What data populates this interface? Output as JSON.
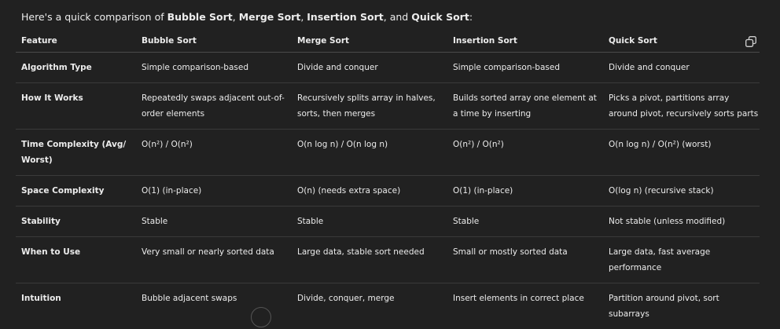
{
  "intro": {
    "prefix": "Here's a quick comparison of ",
    "bubble": "Bubble Sort",
    "sep1": ", ",
    "merge": "Merge Sort",
    "sep2": ", ",
    "insertion": "Insertion Sort",
    "sep3": ", and ",
    "quick": "Quick Sort",
    "suffix": ":"
  },
  "table": {
    "headers": [
      "Feature",
      "Bubble Sort",
      "Merge Sort",
      "Insertion Sort",
      "Quick Sort"
    ],
    "rows": [
      [
        "Algorithm Type",
        "Simple comparison-based",
        "Divide and conquer",
        "Simple comparison-based",
        "Divide and conquer"
      ],
      [
        "How It Works",
        "Repeatedly swaps adjacent out-of-order elements",
        "Recursively splits array in halves, sorts, then merges",
        "Builds sorted array one element at a time by inserting",
        "Picks a pivot, partitions array around pivot, recursively sorts parts"
      ],
      [
        "Time Complexity (Avg/ Worst)",
        "O(n²) / O(n²)",
        "O(n log n) / O(n log n)",
        "O(n²) / O(n²)",
        "O(n log n) / O(n²) (worst)"
      ],
      [
        "Space Complexity",
        "O(1) (in-place)",
        "O(n) (needs extra space)",
        "O(1) (in-place)",
        "O(log n) (recursive stack)"
      ],
      [
        "Stability",
        "Stable",
        "Stable",
        "Stable",
        "Not stable (unless modified)"
      ],
      [
        "When to Use",
        "Very small or nearly sorted data",
        "Large data, stable sort needed",
        "Small or mostly sorted data",
        "Large data, fast average performance"
      ],
      [
        "Intuition",
        "Bubble adjacent swaps",
        "Divide, conquer, merge",
        "Insert elements in correct place",
        "Partition around pivot, sort subarrays"
      ]
    ]
  },
  "icons": {
    "copy": "copy-icon"
  },
  "colors": {
    "background": "#212121",
    "text": "#ececec",
    "divider": "#3a3a3a"
  }
}
